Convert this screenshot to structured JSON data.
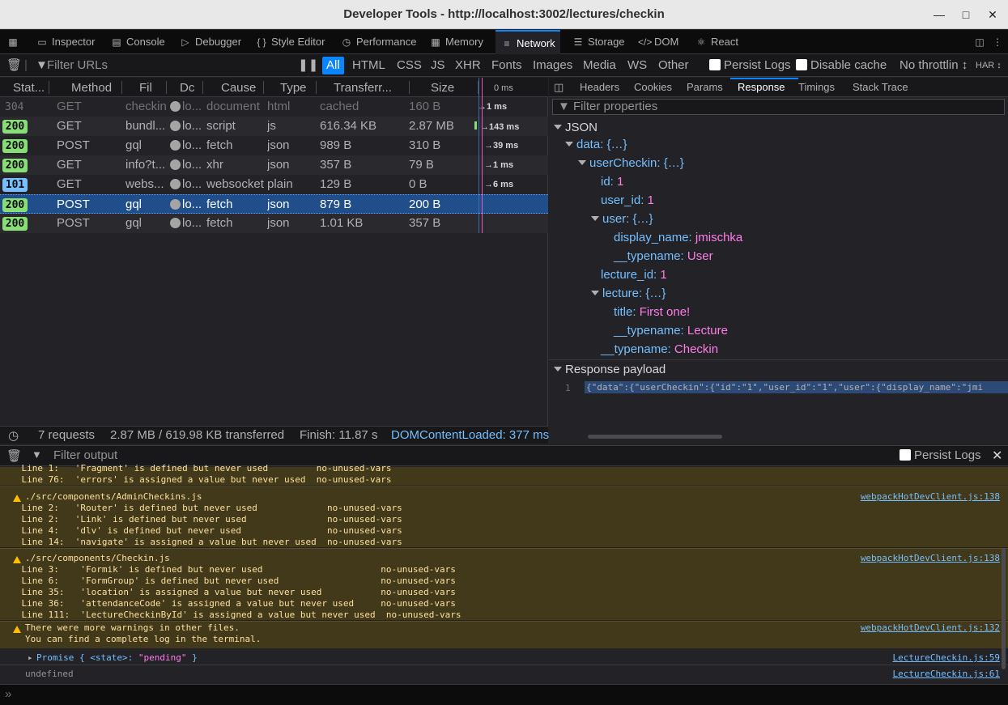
{
  "window": {
    "title": "Developer Tools - http://localhost:3002/lectures/checkin"
  },
  "toolbar": {
    "tabs": [
      {
        "label": "Inspector",
        "icon": "inspector-icon"
      },
      {
        "label": "Console",
        "icon": "console-icon"
      },
      {
        "label": "Debugger",
        "icon": "debugger-icon"
      },
      {
        "label": "Style Editor",
        "icon": "style-editor-icon"
      },
      {
        "label": "Performance",
        "icon": "performance-icon"
      },
      {
        "label": "Memory",
        "icon": "memory-icon"
      },
      {
        "label": "Network",
        "icon": "network-icon"
      },
      {
        "label": "Storage",
        "icon": "storage-icon"
      },
      {
        "label": "DOM",
        "icon": "dom-icon"
      },
      {
        "label": "React",
        "icon": "react-icon"
      }
    ]
  },
  "network": {
    "filter_placeholder": "Filter URLs",
    "type_filters": [
      "All",
      "HTML",
      "CSS",
      "JS",
      "XHR",
      "Fonts",
      "Images",
      "Media",
      "WS",
      "Other"
    ],
    "persist_logs": "Persist Logs",
    "disable_cache": "Disable cache",
    "throttling": "No throttlin ↕",
    "har": "HAR ↕",
    "columns": [
      "Stat...",
      "Method",
      "Fil",
      "Dc",
      "Cause",
      "Type",
      "Transferr...",
      "Size",
      "0 ms"
    ],
    "rows": [
      {
        "status": "304",
        "method": "GET",
        "file": "checkin",
        "domain": "lo...",
        "cause": "document",
        "type": "html",
        "transferred": "cached",
        "size": "160 B",
        "time": "1 ms"
      },
      {
        "status": "200",
        "method": "GET",
        "file": "bundl...",
        "domain": "lo...",
        "cause": "script",
        "type": "js",
        "transferred": "616.34 KB",
        "size": "2.87 MB",
        "time": "143 ms"
      },
      {
        "status": "200",
        "method": "POST",
        "file": "gql",
        "domain": "lo...",
        "cause": "fetch",
        "type": "json",
        "transferred": "989 B",
        "size": "310 B",
        "time": "39 ms"
      },
      {
        "status": "200",
        "method": "GET",
        "file": "info?t...",
        "domain": "lo...",
        "cause": "xhr",
        "type": "json",
        "transferred": "357 B",
        "size": "79 B",
        "time": "1 ms"
      },
      {
        "status": "101",
        "method": "GET",
        "file": "webs...",
        "domain": "lo...",
        "cause": "websocket",
        "type": "plain",
        "transferred": "129 B",
        "size": "0 B",
        "time": "6 ms"
      },
      {
        "status": "200",
        "method": "POST",
        "file": "gql",
        "domain": "lo...",
        "cause": "fetch",
        "type": "json",
        "transferred": "879 B",
        "size": "200 B",
        "time": ""
      },
      {
        "status": "200",
        "method": "POST",
        "file": "gql",
        "domain": "lo...",
        "cause": "fetch",
        "type": "json",
        "transferred": "1.01 KB",
        "size": "357 B",
        "time": ""
      }
    ],
    "summary": {
      "requests": "7 requests",
      "transferred": "2.87 MB / 619.98 KB transferred",
      "finish": "Finish: 11.87 s",
      "domloaded": "DOMContentLoaded: 377 ms"
    }
  },
  "details": {
    "tabs": [
      "Headers",
      "Cookies",
      "Params",
      "Response",
      "Timings",
      "Stack Trace"
    ],
    "filter_placeholder": "Filter properties",
    "json_label": "JSON",
    "tree": {
      "data": "data:",
      "data_val": "{…}",
      "userCheckin": "userCheckin:",
      "userCheckin_val": "{…}",
      "id": "id:",
      "id_val": "1",
      "user_id": "user_id:",
      "user_id_val": "1",
      "user": "user:",
      "user_val": "{…}",
      "display_name": "display_name:",
      "display_name_val": "jmischka",
      "typename_user": "__typename:",
      "typename_user_val": "User",
      "lecture_id": "lecture_id:",
      "lecture_id_val": "1",
      "lecture": "lecture:",
      "lecture_val": "{…}",
      "title": "title:",
      "title_val": "First one!",
      "typename_lecture": "__typename:",
      "typename_lecture_val": "Lecture",
      "typename_checkin": "__typename:",
      "typename_checkin_val": "Checkin"
    },
    "payload_label": "Response payload",
    "payload_line": "1",
    "payload_text": "{\"data\":{\"userCheckin\":{\"id\":\"1\",\"user_id\":\"1\",\"user\":{\"display_name\":\"jmi"
  },
  "console": {
    "filter_placeholder": "Filter output",
    "persist_logs": "Persist Logs",
    "block0": [
      "    Line 1:   'Fragment' is defined but never used         no-unused-vars",
      "    Line 76:  'errors' is assigned a value but never used  no-unused-vars"
    ],
    "block1_title": "./src/components/AdminCheckins.js",
    "block1_src": "webpackHotDevClient.js:138",
    "block1": [
      "    Line 2:   'Router' is defined but never used             no-unused-vars",
      "    Line 2:   'Link' is defined but never used               no-unused-vars",
      "    Line 4:   'dlv' is defined but never used                no-unused-vars",
      "    Line 14:  'navigate' is assigned a value but never used  no-unused-vars"
    ],
    "block2_title": "./src/components/Checkin.js",
    "block2_src": "webpackHotDevClient.js:138",
    "block2": [
      "    Line 3:    'Formik' is defined but never used                      no-unused-vars",
      "    Line 6:    'FormGroup' is defined but never used                   no-unused-vars",
      "    Line 35:   'location' is assigned a value but never used           no-unused-vars",
      "    Line 36:   'attendanceCode' is assigned a value but never used     no-unused-vars",
      "    Line 111:  'LectureCheckinById' is assigned a value but never used  no-unused-vars"
    ],
    "block3_line1": "There were more warnings in other files.",
    "block3_line2": "You can find a complete log in the terminal.",
    "block3_src": "webpackHotDevClient.js:132",
    "promise_prefix": "Promise { ",
    "promise_key": "<state>:",
    "promise_val": " \"pending\"",
    "promise_suffix": " }",
    "promise_src": "LectureCheckin.js:59",
    "undefined_text": "undefined",
    "undefined_src": "LectureCheckin.js:61"
  },
  "colors": {
    "accent": "#0a84ff",
    "ok": "#86de74",
    "info": "#75bfff",
    "warn_bg": "#42381a",
    "warn_text": "#fce19f",
    "selected_row": "#204e8a"
  }
}
